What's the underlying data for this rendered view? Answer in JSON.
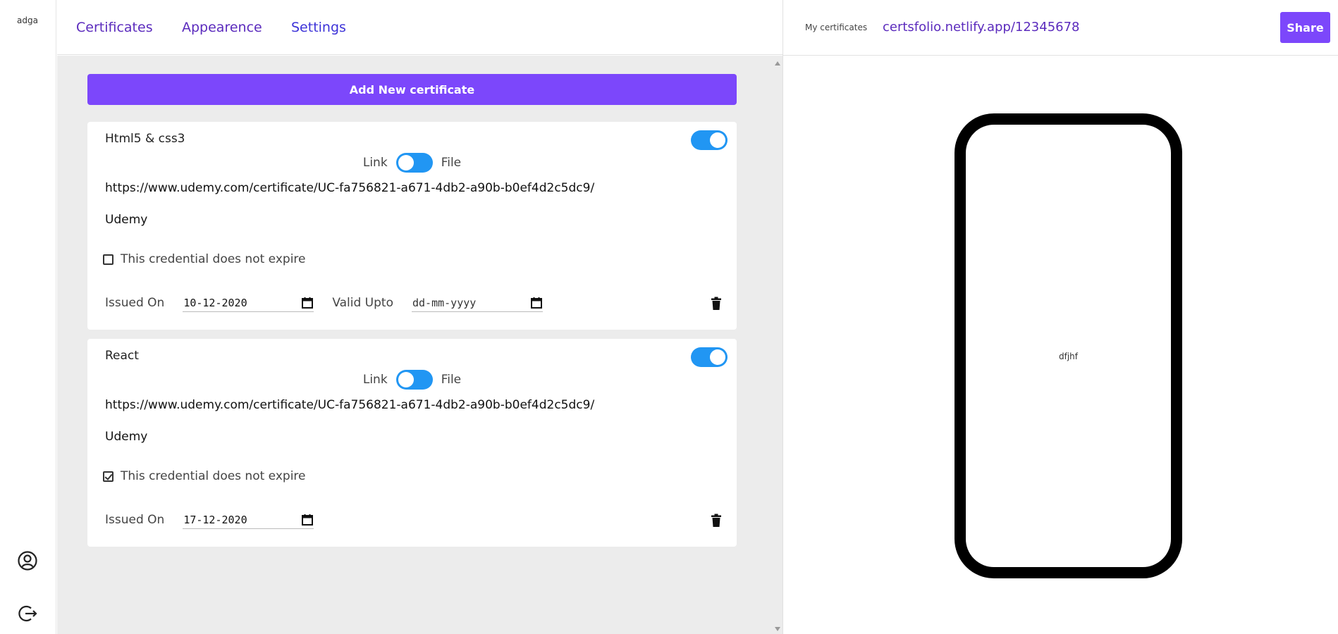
{
  "user": {
    "name": "adga"
  },
  "nav": {
    "tabs": [
      "Certificates",
      "Appearence",
      "Settings"
    ]
  },
  "main": {
    "add_button": "Add New certificate",
    "certificates": [
      {
        "title": "Html5 & css3",
        "enabled": true,
        "link_label": "Link",
        "file_label": "File",
        "url": "https://www.udemy.com/certificate/UC-fa756821-a671-4db2-a90b-b0ef4d2c5dc9/",
        "organization": "Udemy",
        "no_expire_label": "This credential does not expire",
        "no_expire_checked": false,
        "issued_label": "Issued On",
        "issued_value": "10-12-2020",
        "valid_label": "Valid Upto",
        "valid_value": "dd-mm-yyyy"
      },
      {
        "title": "React",
        "enabled": true,
        "link_label": "Link",
        "file_label": "File",
        "url": "https://www.udemy.com/certificate/UC-fa756821-a671-4db2-a90b-b0ef4d2c5dc9/",
        "organization": "Udemy",
        "no_expire_label": "This credential does not expire",
        "no_expire_checked": true,
        "issued_label": "Issued On",
        "issued_value": "17-12-2020"
      }
    ]
  },
  "preview": {
    "my_certificates_label": "My certificates",
    "url": "certsfolio.netlify.app/12345678",
    "share_label": "Share",
    "phone_text": "dfjhf"
  },
  "colors": {
    "accent": "#7c47fb",
    "toggle": "#2196f3",
    "link": "#5b2bbd"
  },
  "icons": [
    "account-circle-icon",
    "logout-icon",
    "calendar-icon",
    "trash-icon"
  ]
}
